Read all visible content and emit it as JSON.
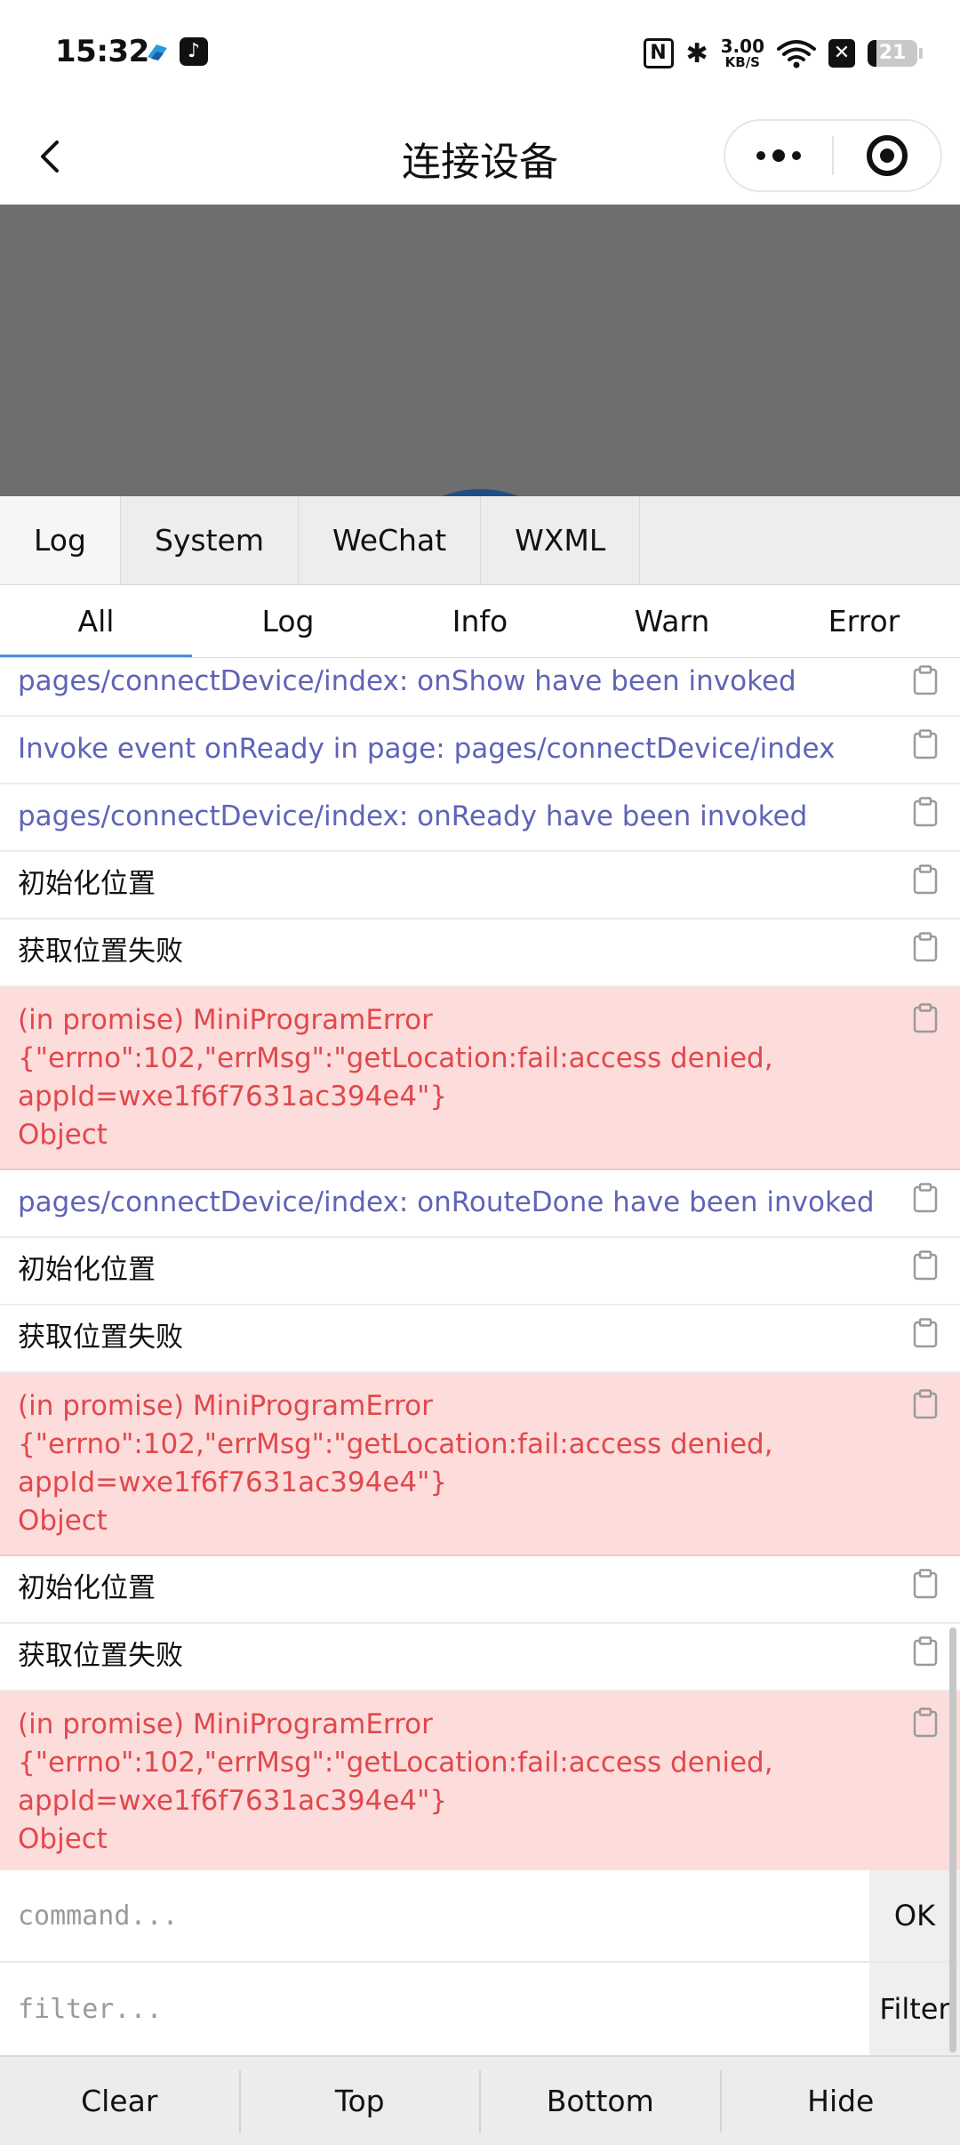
{
  "status_bar": {
    "time": "15:32",
    "app_icon_2": "♪",
    "nfc": "N",
    "bluetooth": "✱",
    "net_speed_value": "3.00",
    "net_speed_unit": "KB/S",
    "sim_icon": "✕",
    "battery": "21"
  },
  "nav": {
    "title": "连接设备"
  },
  "vconsole": {
    "tabs": [
      "Log",
      "System",
      "WeChat",
      "WXML"
    ],
    "subtabs": [
      "All",
      "Log",
      "Info",
      "Warn",
      "Error"
    ],
    "active_subtab": "All",
    "logs": [
      {
        "type": "blue",
        "text": "pages/connectDevice/index: onShow have been invoked"
      },
      {
        "type": "blue",
        "text": "Invoke event onReady in page: pages/connectDevice/index"
      },
      {
        "type": "blue",
        "text": "pages/connectDevice/index: onReady have been invoked"
      },
      {
        "type": "plain",
        "text": "初始化位置"
      },
      {
        "type": "plain",
        "text": "获取位置失败"
      },
      {
        "type": "error",
        "lines": [
          "(in promise) MiniProgramError",
          "{\"errno\":102,\"errMsg\":\"getLocation:fail:access denied,",
          "appId=wxe1f6f7631ac394e4\"}",
          "Object"
        ]
      },
      {
        "type": "blue",
        "text": "pages/connectDevice/index: onRouteDone have been invoked"
      },
      {
        "type": "plain",
        "text": "初始化位置"
      },
      {
        "type": "plain",
        "text": "获取位置失败"
      },
      {
        "type": "error",
        "lines": [
          "(in promise) MiniProgramError",
          "{\"errno\":102,\"errMsg\":\"getLocation:fail:access denied,",
          "appId=wxe1f6f7631ac394e4\"}",
          "Object"
        ]
      },
      {
        "type": "plain",
        "text": "初始化位置"
      },
      {
        "type": "plain",
        "text": "获取位置失败"
      },
      {
        "type": "error",
        "lines": [
          "(in promise) MiniProgramError",
          "{\"errno\":102,\"errMsg\":\"getLocation:fail:access denied,",
          "appId=wxe1f6f7631ac394e4\"}",
          "Object"
        ]
      }
    ],
    "command": {
      "placeholder": "command...",
      "button": "OK"
    },
    "filter": {
      "placeholder": "filter...",
      "button": "Filter"
    },
    "toolbar": [
      "Clear",
      "Top",
      "Bottom",
      "Hide"
    ]
  },
  "colors": {
    "log_blue": "#5f64b8",
    "error_bg": "#fddcdc",
    "error_text": "#e0494c",
    "overlay_gray": "#6e6e6e",
    "active_tab_underline": "#4a90e2"
  },
  "icons": [
    "back-arrow-icon",
    "more-dots-icon",
    "close-ring-icon",
    "clipboard-copy-icon",
    "wifi-icon",
    "bluetooth-icon",
    "nfc-icon",
    "battery-icon"
  ]
}
